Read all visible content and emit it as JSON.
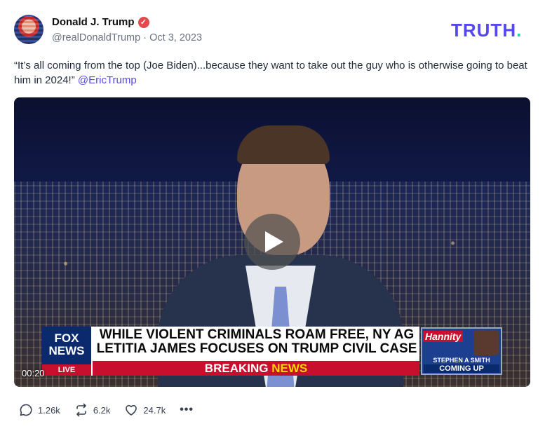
{
  "author": {
    "display_name": "Donald J. Trump",
    "handle": "@realDonaldTrump",
    "separator": "·",
    "date": "Oct 3, 2023"
  },
  "brand": {
    "logo_text": "TRUTH",
    "logo_dot": "."
  },
  "post": {
    "text": "“It’s all coming from the top (Joe Biden)...because they want to take out the guy who is otherwise going to beat him in 2024!”",
    "mention": "@EricTrump"
  },
  "video": {
    "timestamp": "00:20",
    "fox_logo_line1": "FOX",
    "fox_logo_line2": "NEWS",
    "fox_live": "LIVE",
    "headline_line1": "WHILE VIOLENT CRIMINALS ROAM FREE, NY AG",
    "headline_line2": "LETITIA JAMES FOCUSES ON TRUMP CIVIL CASE",
    "breaking_word1": "BREAKING",
    "breaking_word2": "NEWS",
    "show_logo": "Hannity",
    "promo_line1": "STEPHEN A SMITH",
    "promo_line2": "COMING UP"
  },
  "actions": {
    "replies": "1.26k",
    "retruths": "6.2k",
    "likes": "24.7k",
    "more": "•••"
  },
  "icons": [
    "verified-icon",
    "play-icon",
    "reply-icon",
    "retruth-icon",
    "like-icon",
    "more-icon"
  ],
  "colors": {
    "accent": "#5448ee",
    "logo_dot": "#19d79c",
    "verified": "#e5484d",
    "breaking_red": "#c8102e"
  }
}
